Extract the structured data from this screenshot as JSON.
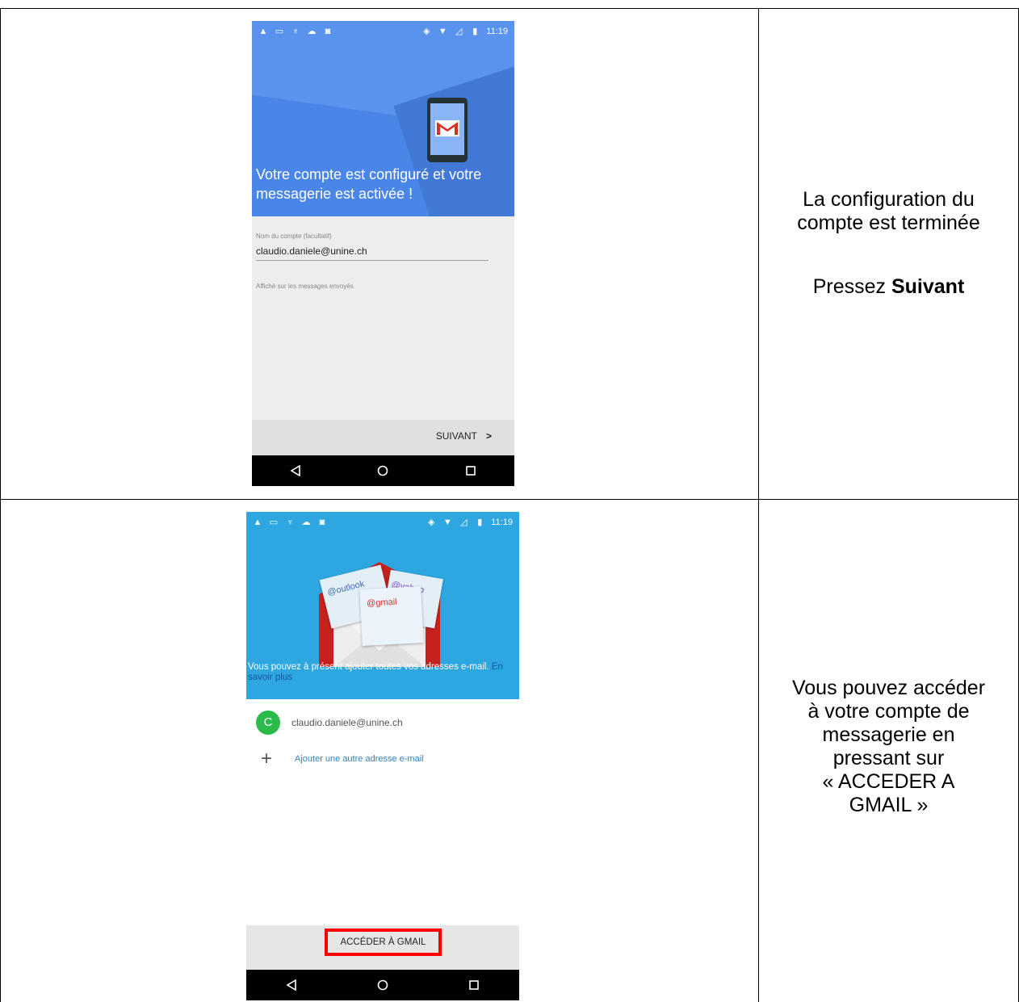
{
  "status_bar": {
    "time": "11:19",
    "left_icons": [
      "warning-icon",
      "screen-icon",
      "usb-icon",
      "cloud-icon",
      "photo-icon"
    ],
    "right_icons": [
      "vibrate-icon",
      "wifi-icon",
      "signal-icon",
      "battery-icon"
    ]
  },
  "row1": {
    "phone": {
      "header_text": "Votre compte est configuré et votre messagerie est activée !",
      "account_name_label": "Nom du compte (facultatif)",
      "account_name_value": "claudio.daniele@unine.ch",
      "helper_text": "Affiché sur les messages envoyés",
      "next_button": "SUIVANT",
      "next_chevron": ">"
    },
    "instruction_line1": "La configuration du",
    "instruction_line2": "compte est terminée",
    "press_prefix": "Pressez ",
    "press_bold": "Suivant"
  },
  "row2": {
    "phone": {
      "card_outlook": "@outlook",
      "card_yahoo": "@yahoo",
      "card_gmail": "@gmail",
      "info_text": "Vous pouvez à présent ajouter toutes vos adresses e-mail.",
      "learn_more": "En savoir plus",
      "avatar_letter": "C",
      "account_email": "claudio.daniele@unine.ch",
      "add_email": "Ajouter une autre adresse e-mail",
      "add_symbol": "+",
      "access_button": "ACCÉDER À GMAIL"
    },
    "instruction_lines": [
      "Vous pouvez accéder",
      "à votre compte de",
      "messagerie en",
      "pressant sur",
      "« ACCEDER A",
      "GMAIL »"
    ]
  },
  "colors": {
    "blue_header": "#4a86e8",
    "cyan_header": "#2ea6e0",
    "gmail_red": "#d93025",
    "highlight_red": "#ff0000",
    "avatar_green": "#2bbb4b",
    "link_blue": "#2d82c9"
  }
}
